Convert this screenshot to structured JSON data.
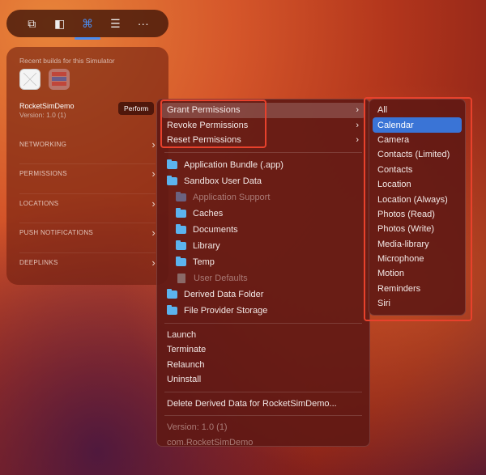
{
  "toolbar": {
    "items": [
      {
        "name": "screenshot-icon",
        "glyph": "⧉"
      },
      {
        "name": "sidebar-icon",
        "glyph": "◧"
      },
      {
        "name": "command-icon",
        "glyph": "⌘"
      },
      {
        "name": "toggles-icon",
        "glyph": "☰"
      },
      {
        "name": "more-icon",
        "glyph": "···"
      }
    ],
    "active_index": 2
  },
  "panel": {
    "recent_label": "Recent builds for this Simulator",
    "app_name": "RocketSimDemo",
    "app_version": "Version: 1.0 (1)",
    "perform_label": "Perform",
    "sections": [
      "NETWORKING",
      "PERMISSIONS",
      "LOCATIONS",
      "PUSH NOTIFICATIONS",
      "DEEPLINKS"
    ]
  },
  "menu": {
    "permissions": [
      "Grant Permissions",
      "Revoke Permissions",
      "Reset Permissions"
    ],
    "folders": [
      "Application Bundle (.app)",
      "Sandbox User Data",
      "Application Support",
      "Caches",
      "Documents",
      "Library",
      "Temp",
      "User Defaults",
      "Derived Data Folder",
      "File Provider Storage"
    ],
    "actions": [
      "Launch",
      "Terminate",
      "Relaunch",
      "Uninstall"
    ],
    "delete": "Delete Derived Data for RocketSimDemo...",
    "version": "Version: 1.0 (1)",
    "bundle": "com.RocketSimDemo"
  },
  "submenu": {
    "items": [
      "All",
      "Calendar",
      "Camera",
      "Contacts (Limited)",
      "Contacts",
      "Location",
      "Location (Always)",
      "Photos (Read)",
      "Photos (Write)",
      "Media-library",
      "Microphone",
      "Motion",
      "Reminders",
      "Siri"
    ],
    "selected": "Calendar"
  },
  "colors": {
    "accent": "#3a74d6",
    "highlight_box": "#e8412c"
  }
}
